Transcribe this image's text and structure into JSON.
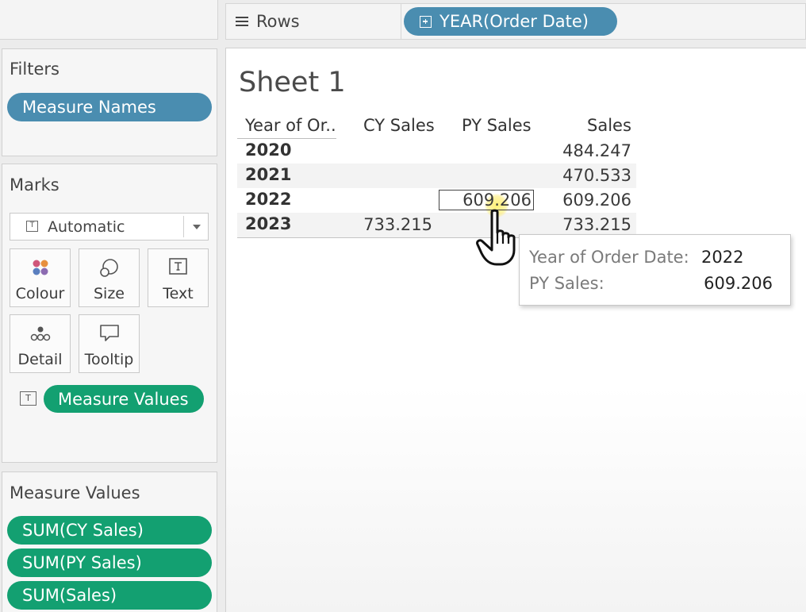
{
  "shelf": {
    "rows_label": "Rows",
    "rows_pill": "YEAR(Order Date)"
  },
  "filters": {
    "title": "Filters",
    "pills": [
      "Measure Names"
    ]
  },
  "marks": {
    "title": "Marks",
    "mark_type": "Automatic",
    "buttons": {
      "colour": "Colour",
      "size": "Size",
      "text": "Text",
      "detail": "Detail",
      "tooltip": "Tooltip"
    },
    "text_pill": "Measure Values"
  },
  "measure_values": {
    "title": "Measure Values",
    "pills": [
      "SUM(CY Sales)",
      "SUM(PY Sales)",
      "SUM(Sales)"
    ]
  },
  "sheet": {
    "title": "Sheet 1",
    "columns": [
      "Year of Or..",
      "CY Sales",
      "PY Sales",
      "Sales"
    ],
    "rows": [
      {
        "year": "2020",
        "cy": "",
        "py": "",
        "sales": "484.247"
      },
      {
        "year": "2021",
        "cy": "",
        "py": "",
        "sales": "470.533"
      },
      {
        "year": "2022",
        "cy": "",
        "py": "609.206",
        "sales": "609.206"
      },
      {
        "year": "2023",
        "cy": "733.215",
        "py": "",
        "sales": "733.215"
      }
    ]
  },
  "tooltip": {
    "rows": [
      {
        "key": "Year of Order Date:",
        "value": "2022"
      },
      {
        "key": "PY Sales:",
        "value": "609.206"
      }
    ]
  },
  "colors": {
    "blue_pill": "#4a8db0",
    "green_pill": "#13a071"
  }
}
